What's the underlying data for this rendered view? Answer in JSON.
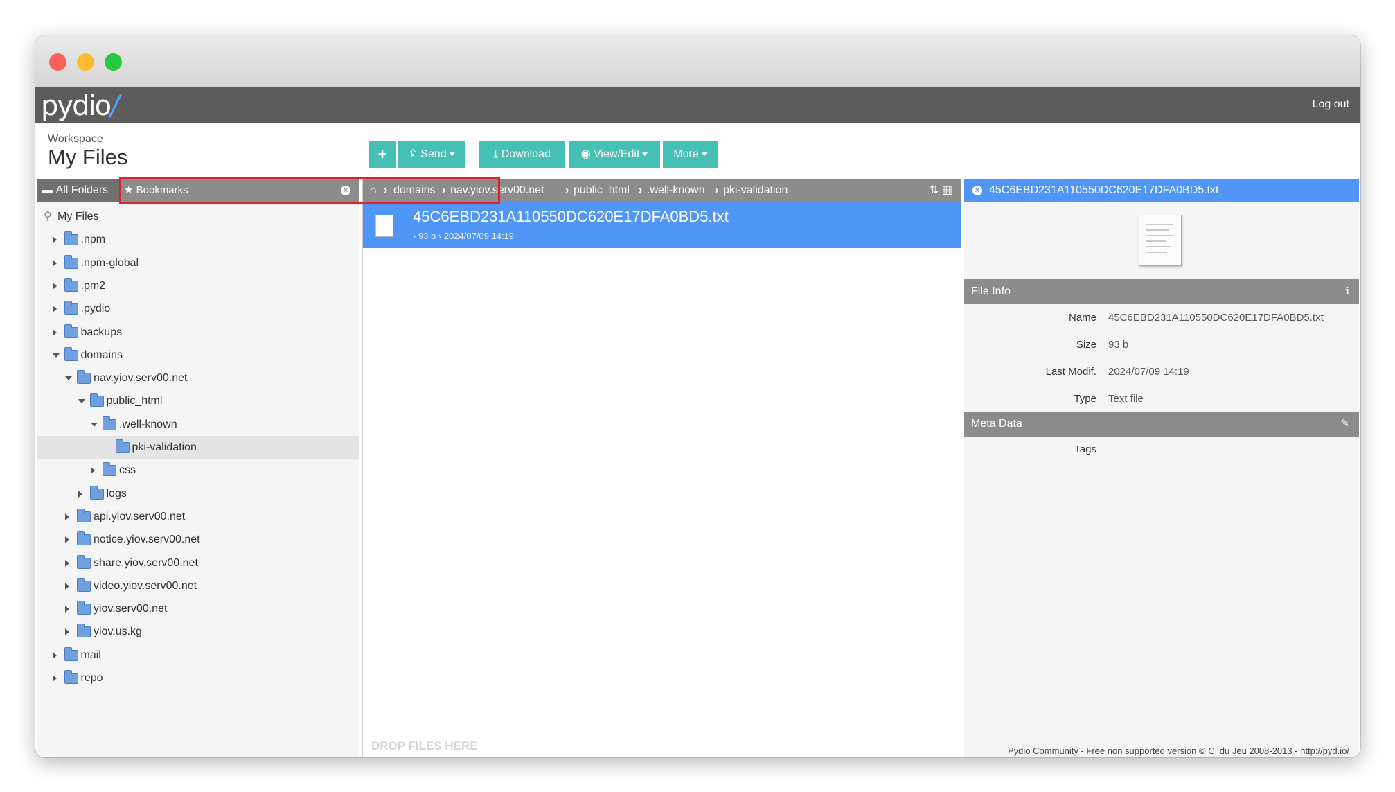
{
  "topbar": {
    "logo": "pydio",
    "logout_label": "Log out"
  },
  "workspace": {
    "label": "Workspace",
    "title": "My Files"
  },
  "toolbar": {
    "add_label": "+",
    "send_label": "Send",
    "download_label": "Download",
    "view_edit_label": "View/Edit",
    "more_label": "More"
  },
  "left_panel": {
    "tab_all": "All Folders",
    "tab_bookmarks": "Bookmarks",
    "tree": [
      {
        "label": "My Files",
        "depth": 0,
        "state": "root"
      },
      {
        "label": ".npm",
        "depth": 1,
        "state": "collapsed"
      },
      {
        "label": ".npm-global",
        "depth": 1,
        "state": "collapsed"
      },
      {
        "label": ".pm2",
        "depth": 1,
        "state": "collapsed"
      },
      {
        "label": ".pydio",
        "depth": 1,
        "state": "collapsed"
      },
      {
        "label": "backups",
        "depth": 1,
        "state": "collapsed"
      },
      {
        "label": "domains",
        "depth": 1,
        "state": "expanded"
      },
      {
        "label": "nav.yiov.serv00.net",
        "depth": 2,
        "state": "expanded"
      },
      {
        "label": "public_html",
        "depth": 3,
        "state": "expanded"
      },
      {
        "label": ".well-known",
        "depth": 4,
        "state": "expanded"
      },
      {
        "label": "pki-validation",
        "depth": 5,
        "state": "selected"
      },
      {
        "label": "css",
        "depth": 4,
        "state": "collapsed"
      },
      {
        "label": "logs",
        "depth": 3,
        "state": "collapsed"
      },
      {
        "label": "api.yiov.serv00.net",
        "depth": 2,
        "state": "collapsed"
      },
      {
        "label": "notice.yiov.serv00.net",
        "depth": 2,
        "state": "collapsed"
      },
      {
        "label": "share.yiov.serv00.net",
        "depth": 2,
        "state": "collapsed"
      },
      {
        "label": "video.yiov.serv00.net",
        "depth": 2,
        "state": "collapsed"
      },
      {
        "label": "yiov.serv00.net",
        "depth": 2,
        "state": "collapsed"
      },
      {
        "label": "yiov.us.kg",
        "depth": 2,
        "state": "collapsed"
      },
      {
        "label": "mail",
        "depth": 1,
        "state": "collapsed"
      },
      {
        "label": "repo",
        "depth": 1,
        "state": "collapsed"
      }
    ]
  },
  "breadcrumb": [
    "domains",
    "nav.yiov.serv00.net",
    "public_html",
    ".well-known",
    "pki-validation"
  ],
  "file_list": {
    "file": {
      "name": "45C6EBD231A110550DC620E17DFA0BD5.txt",
      "size": "93 b",
      "modified": "2024/07/09 14:19"
    },
    "drop_hint": "DROP FILES HERE"
  },
  "details": {
    "title": "45C6EBD231A110550DC620E17DFA0BD5.txt",
    "file_info_label": "File Info",
    "meta_label": "Meta Data",
    "props": [
      {
        "key": "Name",
        "value": "45C6EBD231A110550DC620E17DFA0BD5.txt"
      },
      {
        "key": "Size",
        "value": "93 b"
      },
      {
        "key": "Last Modif.",
        "value": "2024/07/09 14:19"
      },
      {
        "key": "Type",
        "value": "Text file"
      }
    ],
    "tags_label": "Tags"
  },
  "footer": "Pydio Community - Free non supported version © C. du Jeu 2008-2013 - http://pyd.io/",
  "colors": {
    "accent": "#4f96f7",
    "button": "#46bfb5",
    "topbar": "#5c5c5c",
    "highlight": "#e0202c"
  }
}
